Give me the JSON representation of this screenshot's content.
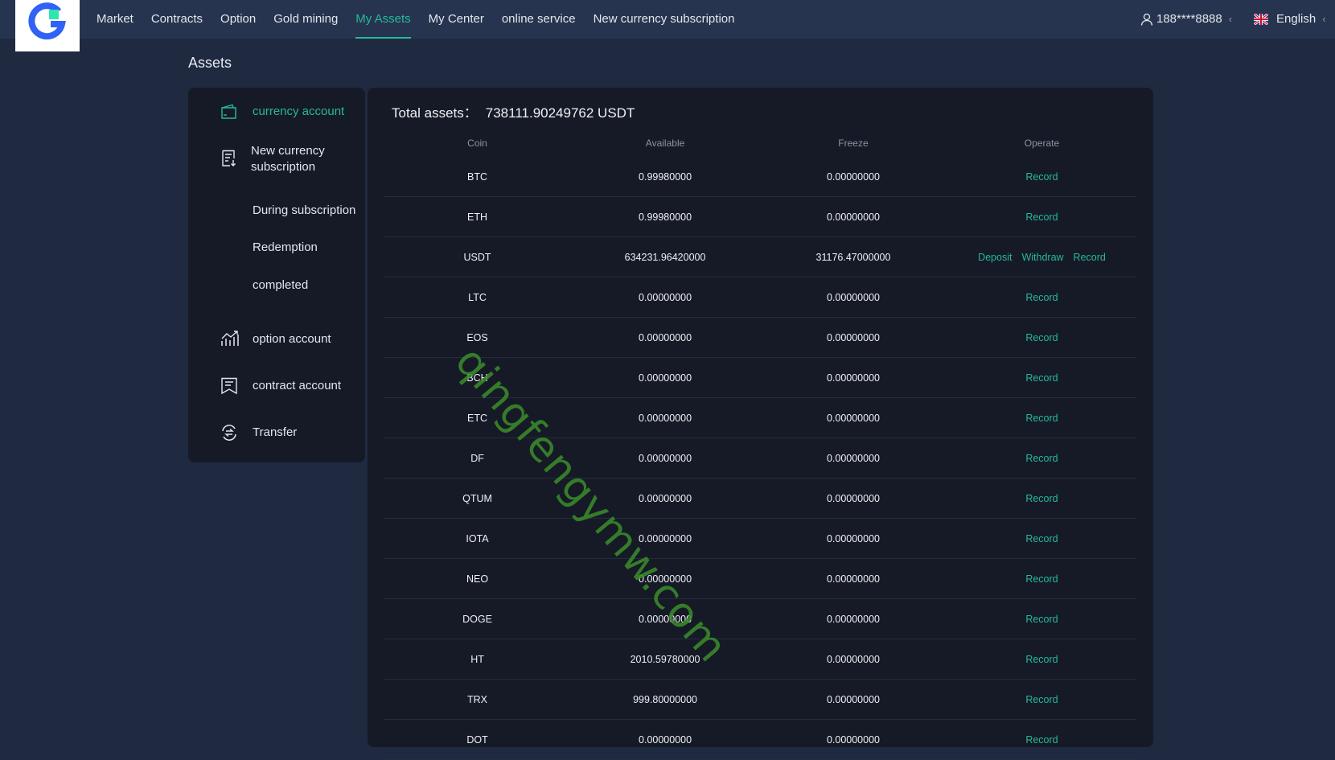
{
  "nav": {
    "items": [
      {
        "label": "Market",
        "active": false
      },
      {
        "label": "Contracts",
        "active": false
      },
      {
        "label": "Option",
        "active": false
      },
      {
        "label": "Gold mining",
        "active": false
      },
      {
        "label": "My Assets",
        "active": true
      },
      {
        "label": "My Center",
        "active": false
      },
      {
        "label": "online service",
        "active": false
      },
      {
        "label": "New currency subscription",
        "active": false
      }
    ],
    "user": {
      "icon": "user-icon",
      "label": "188****8888"
    },
    "language": {
      "icon": "uk-flag-icon",
      "label": "English"
    }
  },
  "page": {
    "title": "Assets"
  },
  "sidebar": {
    "currency_account": "currency account",
    "new_currency_subscription": "New currency subscription",
    "during_subscription": "During subscription",
    "redemption": "Redemption",
    "completed": "completed",
    "option_account": "option account",
    "contract_account": "contract account",
    "transfer": "Transfer"
  },
  "assets": {
    "total_label": "Total assets：",
    "total_value": "738111.90249762 USDT",
    "columns": {
      "coin": "Coin",
      "available": "Available",
      "freeze": "Freeze",
      "operate": "Operate"
    },
    "actions": {
      "deposit": "Deposit",
      "withdraw": "Withdraw",
      "record": "Record"
    },
    "rows": [
      {
        "coin": "BTC",
        "available": "0.99980000",
        "freeze": "0.00000000"
      },
      {
        "coin": "ETH",
        "available": "0.99980000",
        "freeze": "0.00000000"
      },
      {
        "coin": "USDT",
        "available": "634231.96420000",
        "freeze": "31176.47000000"
      },
      {
        "coin": "LTC",
        "available": "0.00000000",
        "freeze": "0.00000000"
      },
      {
        "coin": "EOS",
        "available": "0.00000000",
        "freeze": "0.00000000"
      },
      {
        "coin": "BCH",
        "available": "0.00000000",
        "freeze": "0.00000000"
      },
      {
        "coin": "ETC",
        "available": "0.00000000",
        "freeze": "0.00000000"
      },
      {
        "coin": "DF",
        "available": "0.00000000",
        "freeze": "0.00000000"
      },
      {
        "coin": "QTUM",
        "available": "0.00000000",
        "freeze": "0.00000000"
      },
      {
        "coin": "IOTA",
        "available": "0.00000000",
        "freeze": "0.00000000"
      },
      {
        "coin": "NEO",
        "available": "0.00000000",
        "freeze": "0.00000000"
      },
      {
        "coin": "DOGE",
        "available": "0.00000000",
        "freeze": "0.00000000"
      },
      {
        "coin": "HT",
        "available": "2010.59780000",
        "freeze": "0.00000000"
      },
      {
        "coin": "TRX",
        "available": "999.80000000",
        "freeze": "0.00000000"
      },
      {
        "coin": "DOT",
        "available": "0.00000000",
        "freeze": "0.00000000"
      }
    ]
  },
  "watermark": "qingfengymw.com",
  "colors": {
    "accent": "#25b99b",
    "background": "#1f2940",
    "panel": "#161a27",
    "topbar": "#27344f"
  }
}
